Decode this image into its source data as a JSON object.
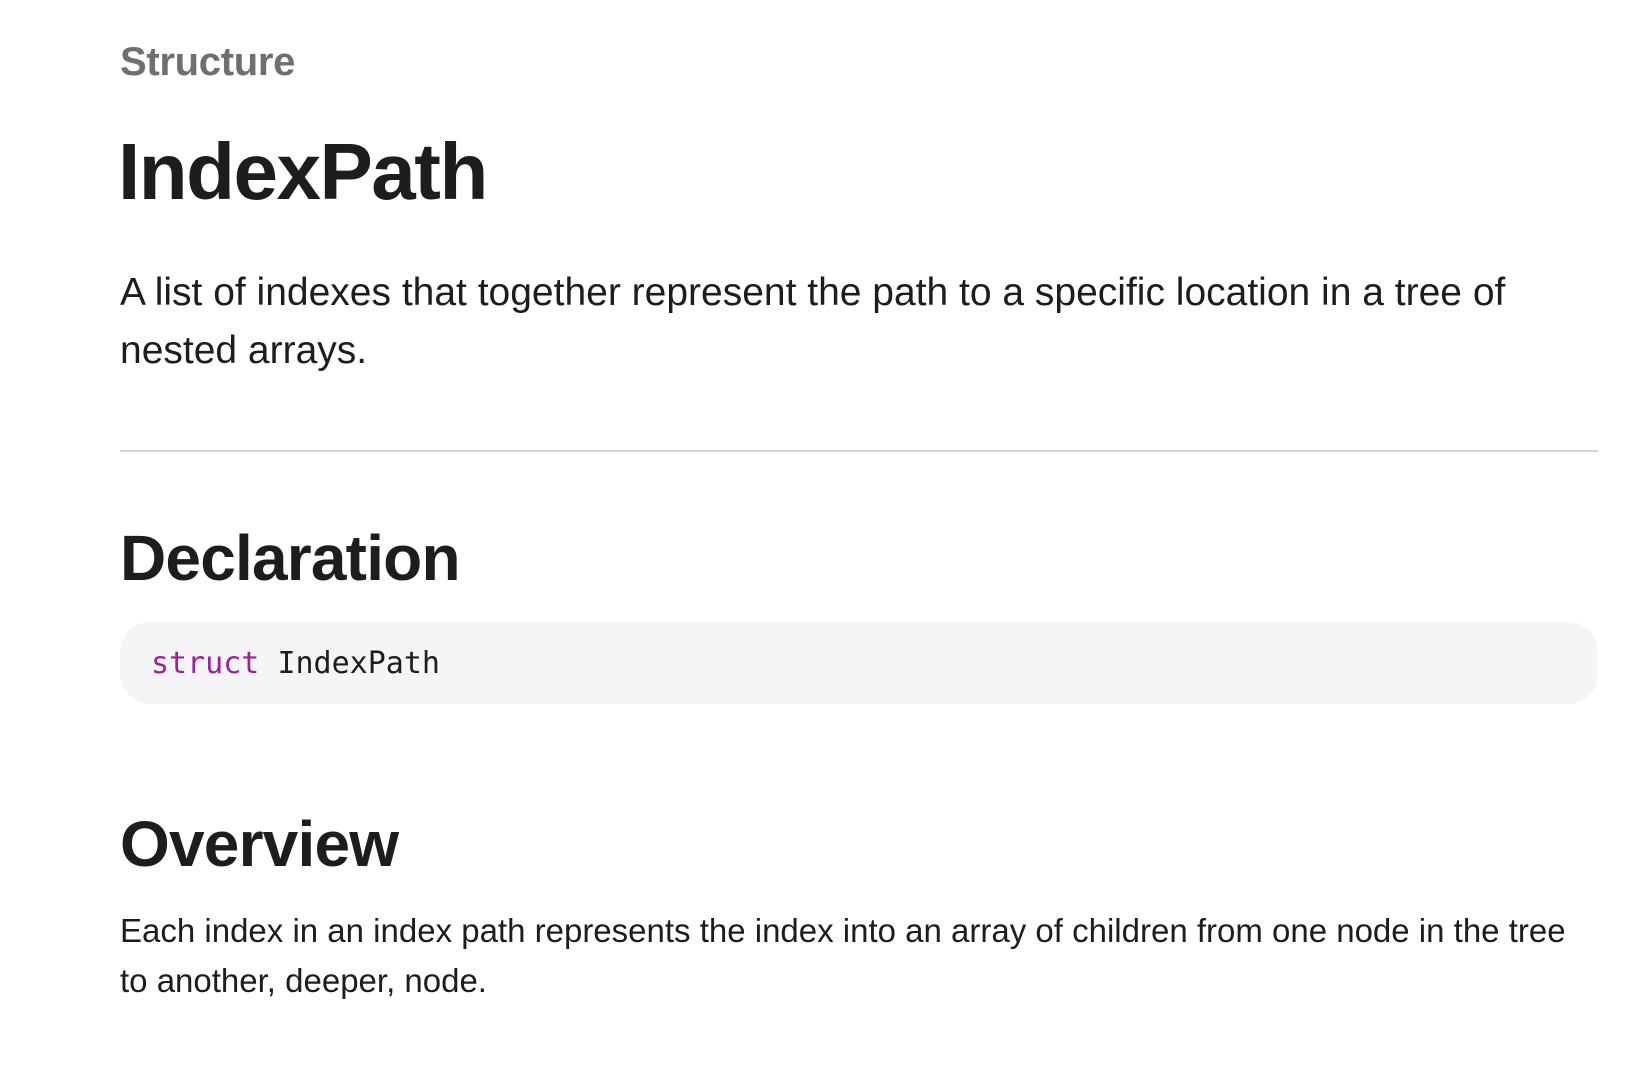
{
  "header": {
    "eyebrow": "Structure",
    "title": "IndexPath"
  },
  "abstract": "A list of indexes that together represent the path to a specific location in a tree of nested arrays.",
  "declaration": {
    "heading": "Declaration",
    "keyword": "struct",
    "name": "IndexPath",
    "keyword_color": "#9b2393"
  },
  "overview": {
    "heading": "Overview",
    "body": "Each index in an index path represents the index into an array of children from one node in the tree to another, deeper, node."
  }
}
